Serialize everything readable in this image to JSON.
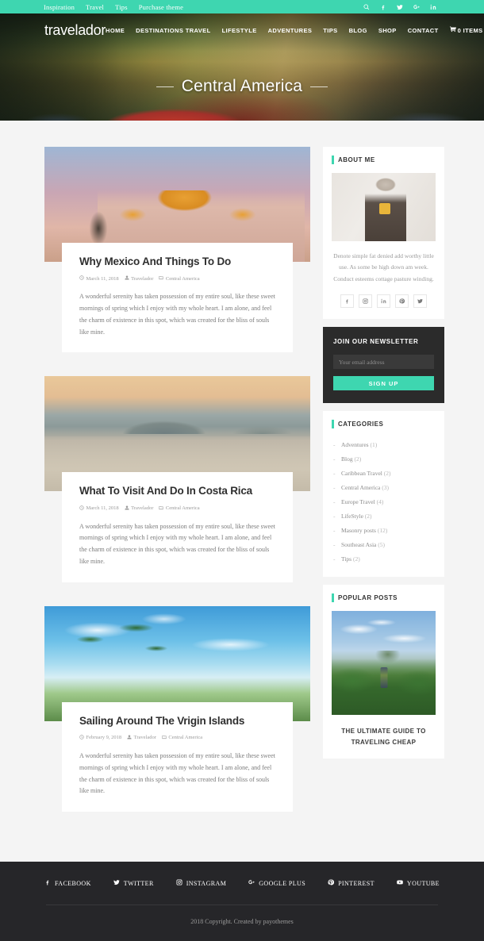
{
  "topbar": {
    "links": [
      "Inspiration",
      "Travel",
      "Tips",
      "Purchase theme"
    ],
    "icons": [
      "search-icon",
      "facebook-icon",
      "twitter-icon",
      "google-plus-icon",
      "linkedin-icon"
    ]
  },
  "header": {
    "logo": "travelador",
    "nav": [
      "HOME",
      "DESTINATIONS TRAVEL",
      "LIFESTYLE",
      "ADVENTURES",
      "TIPS",
      "BLOG",
      "SHOP",
      "CONTACT"
    ],
    "cart_label": "0 ITEMS"
  },
  "hero": {
    "title": "Central America"
  },
  "posts": [
    {
      "title": "Why Mexico And Things To Do",
      "date": "March 11, 2018",
      "author": "Travelador",
      "category": "Central America",
      "excerpt": "A wonderful serenity has taken possession of my entire soul, like these sweet mornings of spring which I enjoy with my whole heart. I am alone, and feel the charm of existence in this spot, which was created for the bliss of souls like mine."
    },
    {
      "title": "What To Visit And Do In Costa Rica",
      "date": "March 11, 2018",
      "author": "Travelador",
      "category": "Central America",
      "excerpt": "A wonderful serenity has taken possession of my entire soul, like these sweet mornings of spring which I enjoy with my whole heart. I am alone, and feel the charm of existence in this spot, which was created for the bliss of souls like mine."
    },
    {
      "title": "Sailing Around The Vrigin Islands",
      "date": "February 9, 2018",
      "author": "Travelador",
      "category": "Central America",
      "excerpt": "A wonderful serenity has taken possession of my entire soul, like these sweet mornings of spring which I enjoy with my whole heart. I am alone, and feel the charm of existence in this spot, which was created for the bliss of souls like mine."
    }
  ],
  "sidebar": {
    "about": {
      "title": "ABOUT ME",
      "text": "Denote simple fat denied add worthy little use. As some be high down am week. Conduct esteems cottage pasture winding.",
      "socials": [
        "facebook-icon",
        "instagram-icon",
        "linkedin-icon",
        "pinterest-icon",
        "twitter-icon"
      ]
    },
    "newsletter": {
      "title": "JOIN OUR NEWSLETTER",
      "placeholder": "Your email address",
      "value": "",
      "button": "SIGN UP"
    },
    "categories": {
      "title": "CATEGORIES",
      "items": [
        {
          "name": "Adventures",
          "count": "(1)"
        },
        {
          "name": "Blog",
          "count": "(2)"
        },
        {
          "name": "Caribbean Travel",
          "count": "(2)"
        },
        {
          "name": "Central America",
          "count": "(3)"
        },
        {
          "name": "Europe Travel",
          "count": "(4)"
        },
        {
          "name": "LifeStyle",
          "count": "(2)"
        },
        {
          "name": "Masonry posts",
          "count": "(12)"
        },
        {
          "name": "Southeast Asia",
          "count": "(5)"
        },
        {
          "name": "Tips",
          "count": "(2)"
        }
      ]
    },
    "popular": {
      "title": "POPULAR POSTS",
      "post_title": "THE ULTIMATE GUIDE TO TRAVELING CHEAP"
    }
  },
  "footer": {
    "socials": [
      {
        "label": "FACEBOOK",
        "icon": "facebook-icon"
      },
      {
        "label": "TWITTER",
        "icon": "twitter-icon"
      },
      {
        "label": "INSTAGRAM",
        "icon": "instagram-icon"
      },
      {
        "label": "GOOGLE PLUS",
        "icon": "google-plus-icon"
      },
      {
        "label": "PINTEREST",
        "icon": "pinterest-icon"
      },
      {
        "label": "YOUTUBE",
        "icon": "youtube-icon"
      }
    ],
    "copyright": "2018 Copyright. Created by payothemes"
  },
  "colors": {
    "accent": "#3ed6b0",
    "dark": "#262629",
    "newsletter_bg": "#2b2b2b"
  }
}
